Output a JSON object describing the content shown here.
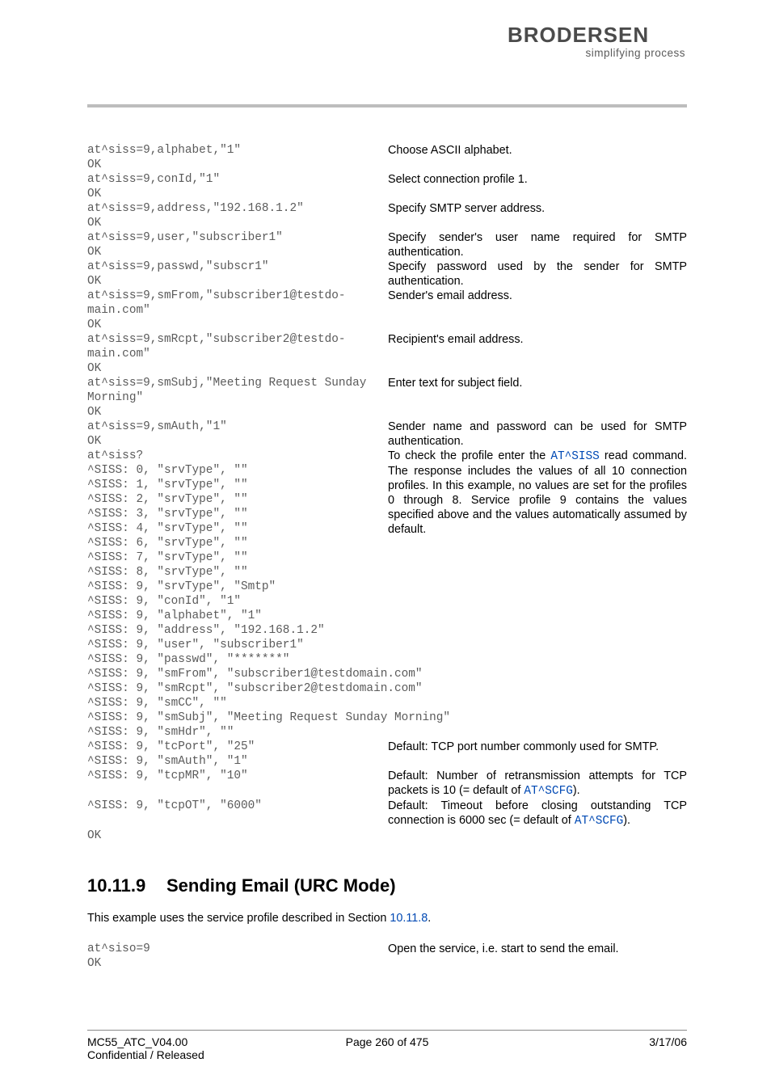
{
  "header": {
    "brand": "BRODERSEN",
    "tagline": "simplifying process"
  },
  "rows": [
    {
      "code": "at^siss=9,alphabet,\"1\"\nOK",
      "desc": [
        {
          "t": "Choose ASCII alphabet."
        }
      ]
    },
    {
      "code": "at^siss=9,conId,\"1\"\nOK",
      "desc": [
        {
          "t": "Select connection profile 1."
        }
      ]
    },
    {
      "code": "at^siss=9,address,\"192.168.1.2\"\nOK",
      "desc": [
        {
          "t": "Specify SMTP server address."
        }
      ]
    },
    {
      "code": "at^siss=9,user,\"subscriber1\"\nOK",
      "desc": [
        {
          "t": "Specify sender's user name required for SMTP authentication."
        }
      ]
    },
    {
      "code": "at^siss=9,passwd,\"subscr1\"\nOK",
      "desc": [
        {
          "t": "Specify password used by the sender for SMTP authentication."
        }
      ]
    },
    {
      "code": "at^siss=9,smFrom,\"subscriber1@testdo-\nmain.com\"\nOK",
      "desc": [
        {
          "t": "Sender's email address."
        }
      ]
    },
    {
      "code": "at^siss=9,smRcpt,\"subscriber2@testdo-\nmain.com\"\nOK",
      "desc": [
        {
          "t": "Recipient's email address."
        }
      ]
    },
    {
      "code": "at^siss=9,smSubj,\"Meeting Request Sunday\nMorning\"\nOK",
      "desc": [
        {
          "t": "Enter text for subject field."
        }
      ]
    },
    {
      "code": "at^siss=9,smAuth,\"1\"\nOK",
      "desc": [
        {
          "t": "Sender name and password can be used for SMTP authentication."
        }
      ]
    },
    {
      "code": "at^siss?\n^SISS: 0, \"srvType\", \"\"\n^SISS: 1, \"srvType\", \"\"\n^SISS: 2, \"srvType\", \"\"\n^SISS: 3, \"srvType\", \"\"\n^SISS: 4, \"srvType\", \"\"\n^SISS: 6, \"srvType\", \"\"\n^SISS: 7, \"srvType\", \"\"\n^SISS: 8, \"srvType\", \"\"\n^SISS: 9, \"srvType\", \"Smtp\"\n^SISS: 9, \"conId\", \"1\"\n^SISS: 9, \"alphabet\", \"1\"\n^SISS: 9, \"address\", \"192.168.1.2\"\n^SISS: 9, \"user\", \"subscriber1\"\n^SISS: 9, \"passwd\", \"*******\"",
      "desc": [
        {
          "t": "To check the profile enter the "
        },
        {
          "t": "AT^SISS",
          "link": true,
          "mono": true
        },
        {
          "t": " read command. The response includes the values of all 10 connection profiles. In this example, no values are set for the profiles 0 through 8. Service profile 9 contains the values specified above and the values automatically assumed by default."
        }
      ]
    },
    {
      "wide": true,
      "code": "^SISS: 9, \"smFrom\", \"subscriber1@testdomain.com\"\n^SISS: 9, \"smRcpt\", \"subscriber2@testdomain.com\"\n^SISS: 9, \"smCC\", \"\"\n^SISS: 9, \"smSubj\", \"Meeting Request Sunday Morning\"\n^SISS: 9, \"smHdr\", \"\""
    },
    {
      "code": "^SISS: 9, \"tcPort\", \"25\"\n^SISS: 9, \"smAuth\", \"1\"",
      "desc": [
        {
          "t": "Default: TCP port number commonly used for SMTP."
        }
      ]
    },
    {
      "code": "^SISS: 9, \"tcpMR\", \"10\"",
      "desc": [
        {
          "t": "Default: Number of retransmission attempts for TCP packets is 10 (= default of "
        },
        {
          "t": "AT^SCFG",
          "link": true,
          "mono": true
        },
        {
          "t": ")."
        }
      ]
    },
    {
      "code": "^SISS: 9, \"tcpOT\", \"6000\"",
      "desc": [
        {
          "t": "Default: Timeout before closing outstanding TCP connection is 6000 sec (= default of "
        },
        {
          "t": "AT^SCFG",
          "link": true,
          "mono": true
        },
        {
          "t": ")."
        }
      ]
    },
    {
      "wide": true,
      "code": "OK"
    }
  ],
  "section": {
    "num": "10.11.9",
    "title": "Sending Email (URC Mode)",
    "intro_parts": [
      {
        "t": "This example uses the service profile described in Section "
      },
      {
        "t": "10.11.8",
        "link": true
      },
      {
        "t": "."
      }
    ]
  },
  "rows2": [
    {
      "code": "at^siso=9\nOK",
      "desc": [
        {
          "t": "Open the service, i.e. start to send the email."
        }
      ]
    }
  ],
  "footer": {
    "left1": "MC55_ATC_V04.00",
    "left2": "Confidential / Released",
    "center": "Page 260 of 475",
    "right": "3/17/06"
  }
}
